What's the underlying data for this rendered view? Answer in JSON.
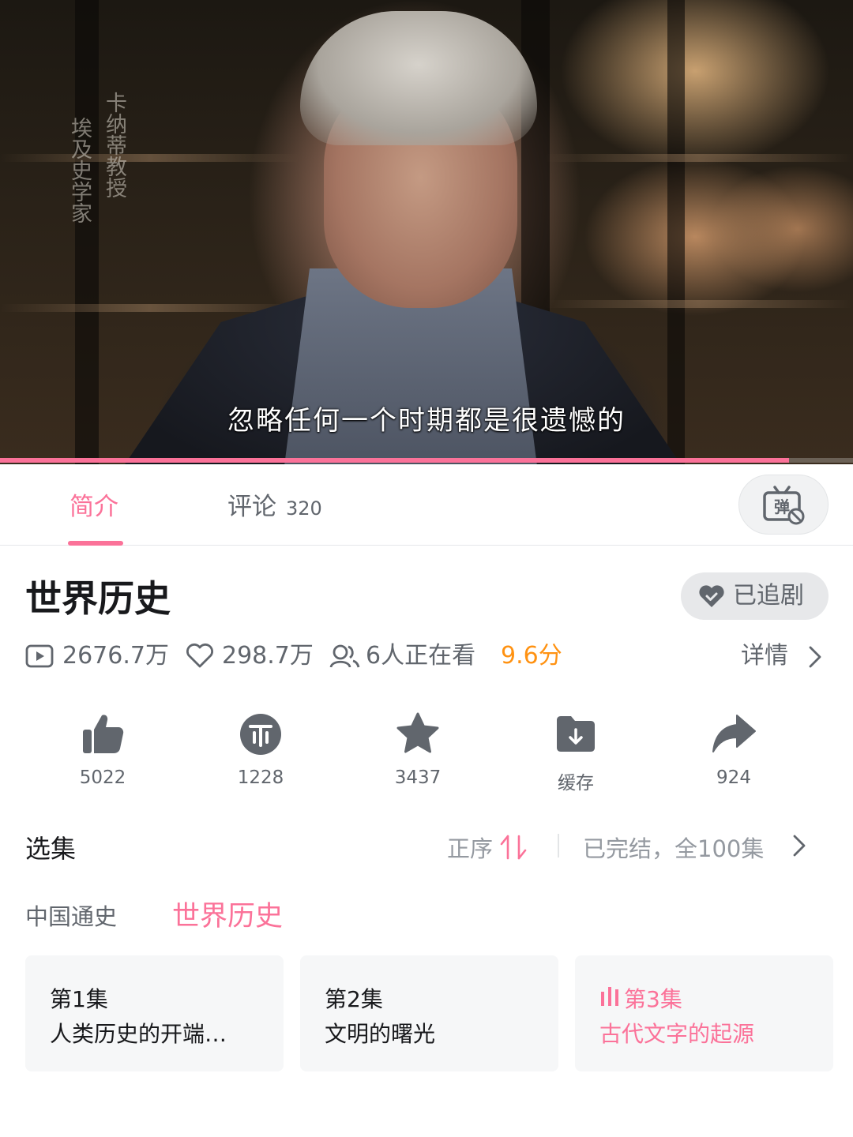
{
  "video": {
    "overlay_caption_col1": "埃及史学家",
    "overlay_caption_col2": "卡纳蒂教授",
    "subtitle": "忽略任何一个时期都是很遗憾的",
    "progress_fraction": 0.925
  },
  "tabs": {
    "intro_label": "简介",
    "comments_label": "评论",
    "comments_count": "320",
    "danmaku_icon": "danmaku-off-icon"
  },
  "show": {
    "title": "世界历史",
    "follow_label": "已追剧"
  },
  "stats": {
    "plays": "2676.7万",
    "likes": "298.7万",
    "watching": "6人正在看",
    "score": "9.6分",
    "details_label": "详情"
  },
  "actions": [
    {
      "icon": "thumbs-up-icon",
      "label": "5022"
    },
    {
      "icon": "coin-icon",
      "label": "1228"
    },
    {
      "icon": "star-icon",
      "label": "3437"
    },
    {
      "icon": "download-folder-icon",
      "label": "缓存"
    },
    {
      "icon": "share-icon",
      "label": "924"
    }
  ],
  "episodes": {
    "section_title": "选集",
    "order_label": "正序",
    "status_label": "已完结，全100集",
    "seasons": [
      "中国通史",
      "世界历史"
    ],
    "active_season": "世界历史",
    "items": [
      {
        "number": "第1集",
        "title": "人类历史的开端…"
      },
      {
        "number": "第2集",
        "title": "文明的曙光"
      },
      {
        "number": "第3集",
        "title": "古代文字的起源"
      }
    ],
    "playing_index": 2
  },
  "colors": {
    "accent": "#fb7299",
    "score": "#ff9212",
    "text_primary": "#18191c",
    "text_secondary": "#61666d"
  }
}
